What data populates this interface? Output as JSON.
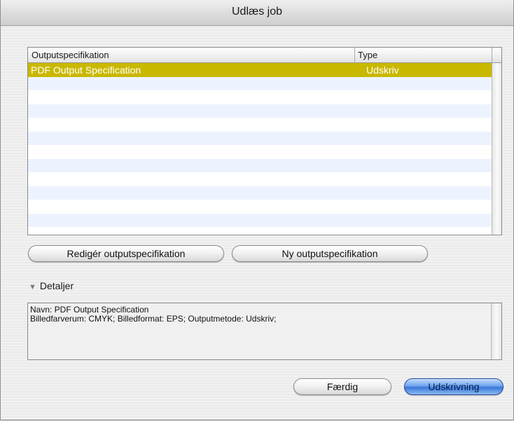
{
  "window": {
    "title": "Udlæs job"
  },
  "table": {
    "columns": [
      "Outputspecifikation",
      "Type"
    ],
    "rows": [
      {
        "name": "PDF Output Specification",
        "type": "Udskriv"
      }
    ]
  },
  "buttons": {
    "edit": "Redigér outputspecifikation",
    "new": "Ny outputspecifikation",
    "done": "Færdig",
    "print": "Udskrivning"
  },
  "details": {
    "label": "Detaljer",
    "line1": "Navn: PDF Output Specification",
    "line2": "Billedfarverum: CMYK; Billedformat: EPS; Outputmetode: Udskriv;"
  },
  "colors": {
    "selection": "#c9b800",
    "stripe": "#edf3fe",
    "primary_button": "#3a78d8"
  }
}
